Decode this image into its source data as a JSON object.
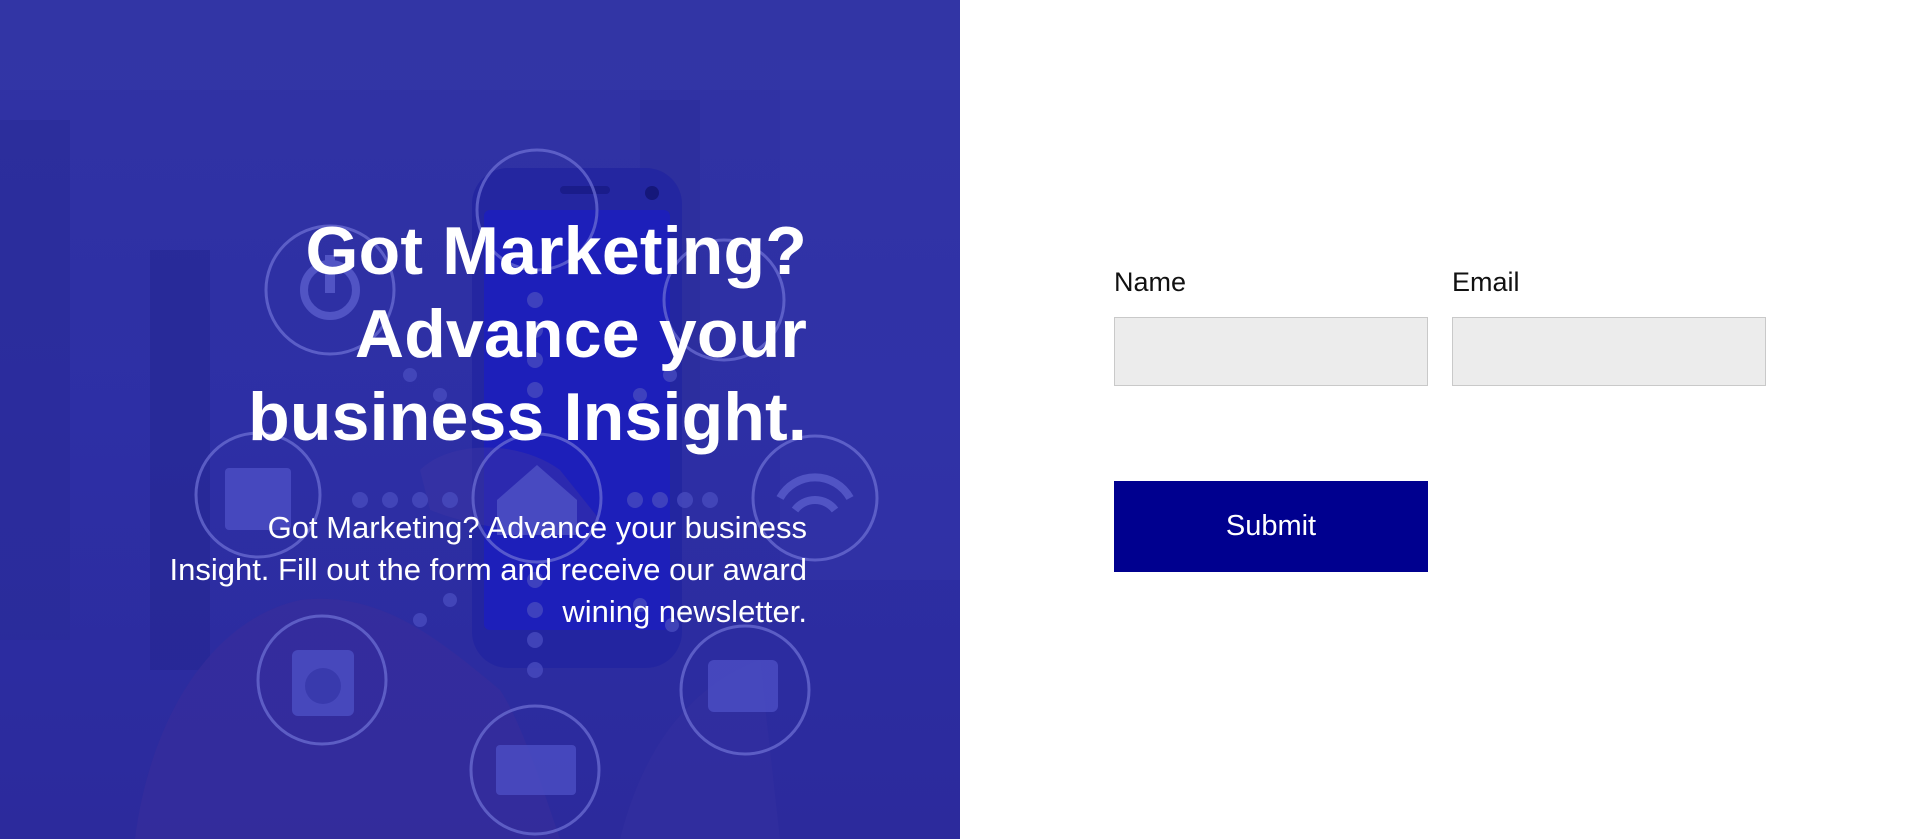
{
  "hero": {
    "title_lines": [
      "Got Marketing?",
      "Advance your",
      "business Insight."
    ],
    "text": "Got Marketing? Advance your business Insight. Fill out the form and receive our award wining newsletter.",
    "overlay_color": "#2e30a6",
    "background_icons": [
      "power-icon",
      "plug-icon",
      "home-icon",
      "lightbulb-icon",
      "wifi-icon",
      "washing-machine-icon",
      "tv-icon",
      "fridge-icon",
      "smartphone-icon"
    ]
  },
  "form": {
    "name_label": "Name",
    "name_value": "",
    "email_label": "Email",
    "email_value": "",
    "submit_label": "Submit",
    "submit_color": "#00008f",
    "input_background": "#ececec"
  }
}
